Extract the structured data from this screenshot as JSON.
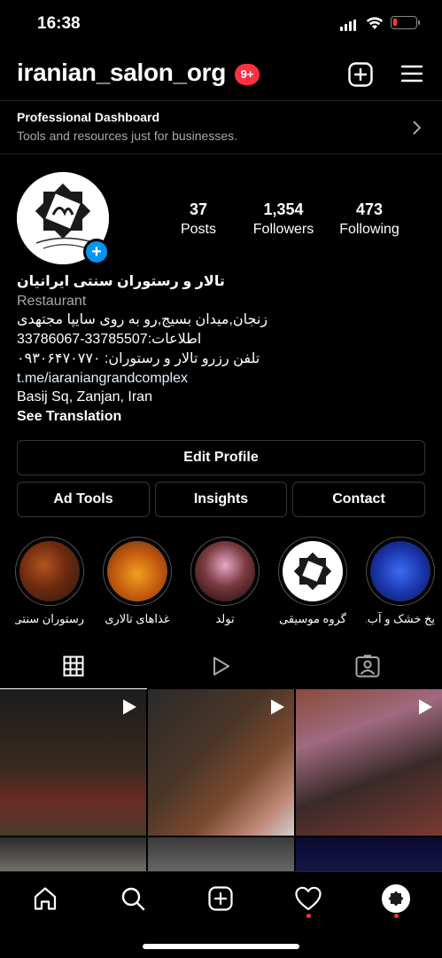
{
  "status_bar": {
    "time": "16:38"
  },
  "header": {
    "username": "iranian_salon_org",
    "notification_badge": "9+"
  },
  "dashboard": {
    "title": "Professional Dashboard",
    "subtitle": "Tools and resources just for businesses."
  },
  "profile": {
    "stats": [
      {
        "value": "37",
        "label": "Posts"
      },
      {
        "value": "1,354",
        "label": "Followers"
      },
      {
        "value": "473",
        "label": "Following"
      }
    ],
    "name": "تالار و رستوران سنتی ایرانیان",
    "category": "Restaurant",
    "bio_lines": [
      "زنجان,میدان بسیج,رو به روی سایپا مجتهدی",
      "اطلاعات:33785507-33786067",
      "تلفن رزرو تالار و رستوران: ۰۹۳۰۶۴۷۰۷۷۰"
    ],
    "link": "t.me/iaraniangrandcomplex",
    "location": "Basij Sq, Zanjan, Iran",
    "see_translation": "See Translation"
  },
  "buttons": {
    "edit_profile": "Edit Profile",
    "ad_tools": "Ad Tools",
    "insights": "Insights",
    "contact": "Contact"
  },
  "highlights": [
    {
      "label": "رستوران سنتی"
    },
    {
      "label": "غذاهای تالاری"
    },
    {
      "label": "تولد"
    },
    {
      "label": "گروه موسیقی"
    },
    {
      "label": "یخ خشک و آب..."
    }
  ],
  "tabs": [
    "grid-icon",
    "reels-icon",
    "tagged-icon"
  ],
  "bottom_nav": [
    "home-icon",
    "search-icon",
    "create-icon",
    "activity-icon",
    "profile-avatar"
  ],
  "colors": {
    "accent_blue": "#0095f6",
    "badge_red": "#ff3040",
    "secondary_text": "#a8a8a8",
    "border": "#363636"
  }
}
